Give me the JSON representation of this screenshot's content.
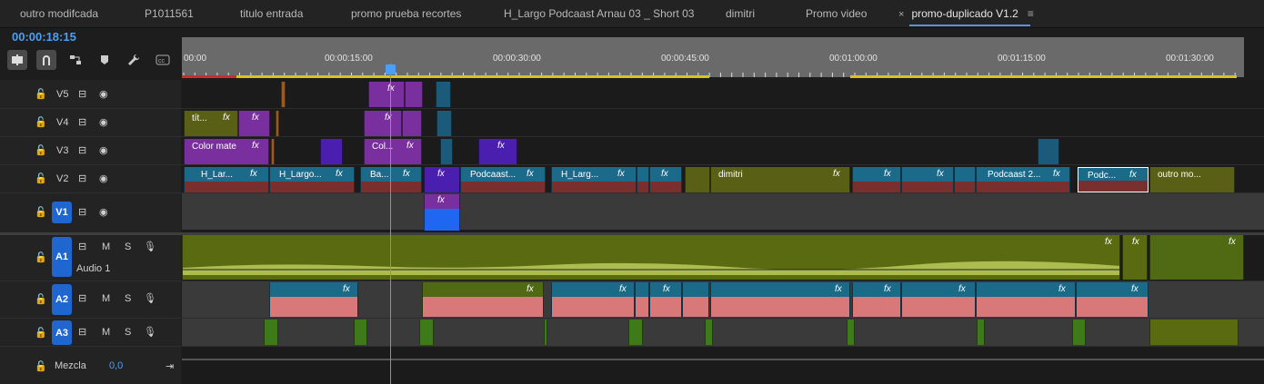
{
  "tabs": [
    {
      "label": "outro modifcada"
    },
    {
      "label": "P1011561"
    },
    {
      "label": "titulo entrada"
    },
    {
      "label": "promo prueba recortes"
    },
    {
      "label": "H_Largo Podcaast Arnau 03 _ Short 03"
    },
    {
      "label": "dimitri"
    },
    {
      "label": "Promo video"
    },
    {
      "label": "promo-duplicado V1.2",
      "close": "×",
      "menu": "≡"
    }
  ],
  "timecode": "00:00:18:15",
  "ruler": {
    "labels": [
      "00:00",
      "00:00:15:00",
      "00:00:30:00",
      "00:00:45:00",
      "00:01:00:00",
      "00:01:15:00",
      "00:01:30:00"
    ]
  },
  "tracks": {
    "v5": {
      "name": "V5"
    },
    "v4": {
      "name": "V4"
    },
    "v3": {
      "name": "V3"
    },
    "v2": {
      "name": "V2"
    },
    "v1": {
      "name": "V1"
    },
    "a1": {
      "name": "A1",
      "label": "Audio 1",
      "m": "M",
      "s": "S"
    },
    "a2": {
      "name": "A2",
      "m": "M",
      "s": "S"
    },
    "a3": {
      "name": "A3",
      "m": "M",
      "s": "S"
    },
    "mix": {
      "label": "Mezcla",
      "value": "0,0"
    }
  },
  "clips": {
    "fx": "fx",
    "v4_tit": "tít...",
    "v3_color": "Color mate",
    "v3_col": "Col...",
    "v2_hlar": "H_Lar...",
    "v2_hlargo": "H_Largo...",
    "v2_ba": "Ba...",
    "v2_podcaast": "Podcaast...",
    "v2_hlarg": "H_Larg...",
    "v2_dimitri": "dimitri",
    "v2_podcaast2": "Podcaast 2...",
    "v2_podc": "Podc...",
    "v2_outro": "outro mo..."
  },
  "colors": {
    "accent": "#4c9ff7",
    "purple": "#7a2f9e",
    "teal": "#1b6a8a",
    "olive": "#5a5f16",
    "audio_green": "#4f6a12",
    "audio_pink": "#d97878",
    "blue_sel": "#1f66d1"
  }
}
